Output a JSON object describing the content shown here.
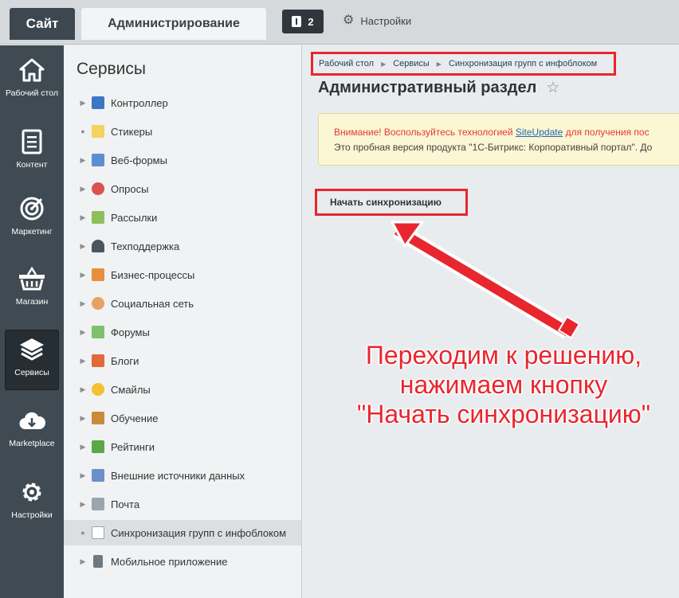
{
  "header": {
    "tab_site": "Сайт",
    "tab_admin": "Администрирование",
    "notifications_count": "2",
    "settings_label": "Настройки"
  },
  "left_menu": [
    {
      "label": "Рабочий стол",
      "icon": "home-icon"
    },
    {
      "label": "Контент",
      "icon": "document-icon"
    },
    {
      "label": "Маркетинг",
      "icon": "target-icon"
    },
    {
      "label": "Магазин",
      "icon": "basket-icon"
    },
    {
      "label": "Сервисы",
      "icon": "layers-icon",
      "active": true
    },
    {
      "label": "Marketplace",
      "icon": "cloud-download-icon"
    },
    {
      "label": "Настройки",
      "icon": "gear-icon"
    }
  ],
  "services": {
    "title": "Сервисы",
    "items": [
      {
        "label": "Контроллер",
        "icon": "controller-icon"
      },
      {
        "label": "Стикеры",
        "icon": "stickers-icon"
      },
      {
        "label": "Веб-формы",
        "icon": "webforms-icon"
      },
      {
        "label": "Опросы",
        "icon": "polls-icon"
      },
      {
        "label": "Рассылки",
        "icon": "mail-icon"
      },
      {
        "label": "Техподдержка",
        "icon": "headset-icon"
      },
      {
        "label": "Бизнес-процессы",
        "icon": "bizproc-icon"
      },
      {
        "label": "Социальная сеть",
        "icon": "social-icon"
      },
      {
        "label": "Форумы",
        "icon": "forum-icon"
      },
      {
        "label": "Блоги",
        "icon": "blog-icon"
      },
      {
        "label": "Смайлы",
        "icon": "smile-icon"
      },
      {
        "label": "Обучение",
        "icon": "learning-icon"
      },
      {
        "label": "Рейтинги",
        "icon": "rating-icon"
      },
      {
        "label": "Внешние источники данных",
        "icon": "rss-icon"
      },
      {
        "label": "Почта",
        "icon": "mailbox-icon"
      },
      {
        "label": "Синхронизация групп с инфоблоком",
        "icon": "page-icon",
        "active": true
      },
      {
        "label": "Мобильное приложение",
        "icon": "mobile-icon"
      }
    ]
  },
  "breadcrumb": [
    "Рабочий стол",
    "Сервисы",
    "Синхронизация групп с инфоблоком"
  ],
  "page_title": "Административный раздел",
  "alert": {
    "line1_prefix": "Внимание! Воспользуйтесь технологией ",
    "line1_link": "SiteUpdate",
    "line1_suffix": " для получения пос",
    "line2": "Это пробная версия продукта \"1С-Битрикс: Корпоративный портал\". До"
  },
  "sync_button": "Начать синхронизацию",
  "annotation": {
    "line1": "Переходим к решению,",
    "line2": "нажимаем кнопку",
    "line3": "\"Начать синхронизацию\""
  },
  "colors": {
    "highlight_red": "#e8262e",
    "menu_dark": "#3f4a52",
    "alert_bg": "#fbf6d3"
  }
}
